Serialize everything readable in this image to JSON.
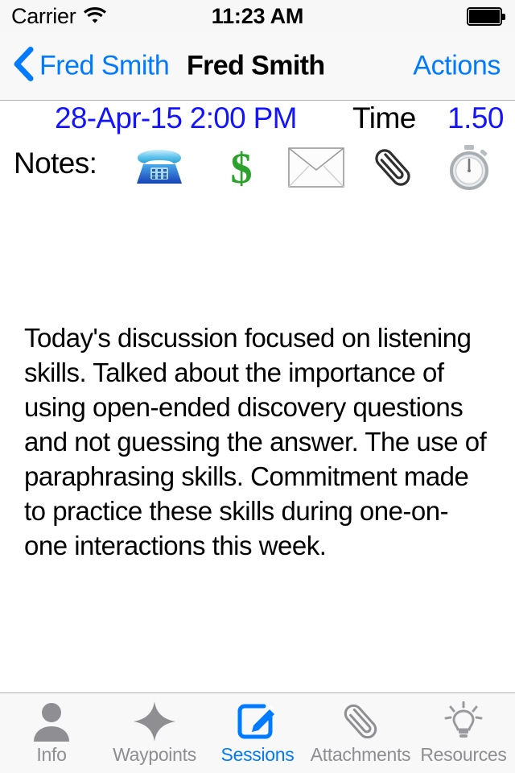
{
  "status_bar": {
    "carrier": "Carrier",
    "wifi_icon": "wifi-icon",
    "time": "11:23 AM",
    "battery_icon": "battery-full-icon"
  },
  "nav_bar": {
    "back_icon": "chevron-left-icon",
    "back_label": "Fred Smith",
    "title": "Fred Smith",
    "actions_label": "Actions"
  },
  "session_header": {
    "datetime": "28-Apr-15 2:00 PM",
    "time_label": "Time",
    "time_value": "1.50",
    "notes_label": "Notes:",
    "action_icons": [
      {
        "name": "telephone-icon",
        "glyph": "telephone"
      },
      {
        "name": "dollar-icon",
        "glyph": "dollar"
      },
      {
        "name": "envelope-icon",
        "glyph": "envelope"
      },
      {
        "name": "paperclip-icon",
        "glyph": "paperclip"
      },
      {
        "name": "stopwatch-icon",
        "glyph": "stopwatch"
      }
    ]
  },
  "note": {
    "text": "Today's discussion focused on listening skills. Talked about the importance of using open-ended discovery questions and not guessing the answer. The use of paraphrasing skills. Commitment made to practice these skills during one-on-one interactions this week."
  },
  "tab_bar": {
    "items": [
      {
        "label": "Info",
        "icon": "person-icon",
        "active": false
      },
      {
        "label": "Waypoints",
        "icon": "star-four-point-icon",
        "active": false
      },
      {
        "label": "Sessions",
        "icon": "compose-icon",
        "active": true
      },
      {
        "label": "Attachments",
        "icon": "paperclip-icon",
        "active": false
      },
      {
        "label": "Resources",
        "icon": "lightbulb-icon",
        "active": false
      }
    ]
  },
  "colors": {
    "accent_blue": "#007aff",
    "value_blue": "#1414ff",
    "inactive_gray": "#8e8e93",
    "bar_background": "#f8f8f8"
  }
}
